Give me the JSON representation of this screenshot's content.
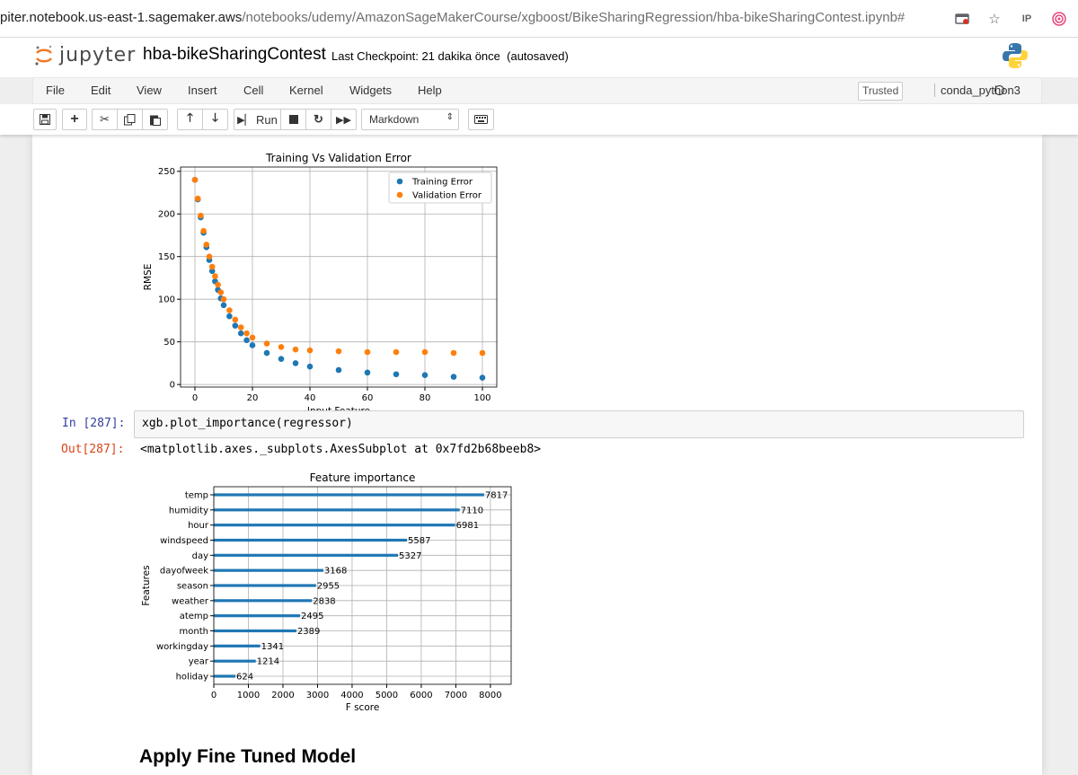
{
  "browser": {
    "url_host": "piter.notebook.us-east-1.sagemaker.aws",
    "url_path": "/notebooks/udemy/AmazonSageMakerCourse/xgboost/BikeSharingRegression/hba-bikeSharingContest.ipynb#",
    "icons": [
      "camera-blocked-icon",
      "star-icon",
      "ip-extension-icon",
      "target-extension-icon",
      "overflow-icon"
    ]
  },
  "header": {
    "logo_text": "jupyter",
    "notebook_name": "hba-bikeSharingContest",
    "checkpoint_text": "Last Checkpoint: 21 dakika önce",
    "autosave_text": "(autosaved)"
  },
  "menu": {
    "items": [
      "File",
      "Edit",
      "View",
      "Insert",
      "Cell",
      "Kernel",
      "Widgets",
      "Help"
    ],
    "trusted_label": "Trusted",
    "kernel_label": "conda_python3"
  },
  "toolbar": {
    "run_label": "Run",
    "cell_type": "Markdown"
  },
  "cells": {
    "in_prompt": "In [287]:",
    "code": "xgb.plot_importance(regressor)",
    "out_prompt": "Out[287]:",
    "output": "<matplotlib.axes._subplots.AxesSubplot at 0x7fd2b68beeb8>",
    "markdown_heading": "Apply Fine Tuned Model"
  },
  "colors": {
    "training": "#1f77b4",
    "validation": "#ff7f0e",
    "bars": "#1f77b4",
    "in_prompt": "#303f9f",
    "out_prompt": "#d84315"
  },
  "chart_data": [
    {
      "type": "scatter",
      "title": "Training Vs Validation Error",
      "xlabel": "Input Feature",
      "ylabel": "RMSE",
      "xlim": [
        -5,
        105
      ],
      "ylim": [
        -3,
        255
      ],
      "xticks": [
        0,
        20,
        40,
        60,
        80,
        100
      ],
      "yticks": [
        0,
        50,
        100,
        150,
        200,
        250
      ],
      "grid": true,
      "legend": "top-right",
      "series": [
        {
          "name": "Training Error",
          "x": [
            0,
            1,
            2,
            3,
            4,
            5,
            6,
            7,
            8,
            9,
            10,
            12,
            14,
            16,
            18,
            20,
            25,
            30,
            35,
            40,
            50,
            60,
            70,
            80,
            90,
            100
          ],
          "y": [
            240,
            217,
            196,
            178,
            161,
            146,
            133,
            121,
            111,
            101,
            93,
            80,
            69,
            60,
            52,
            46,
            37,
            30,
            25,
            21,
            17,
            14,
            12,
            11,
            9,
            8
          ]
        },
        {
          "name": "Validation Error",
          "x": [
            0,
            1,
            2,
            3,
            4,
            5,
            6,
            7,
            8,
            9,
            10,
            12,
            14,
            16,
            18,
            20,
            25,
            30,
            35,
            40,
            50,
            60,
            70,
            80,
            90,
            100
          ],
          "y": [
            240,
            218,
            198,
            180,
            164,
            150,
            138,
            127,
            117,
            108,
            100,
            87,
            76,
            67,
            60,
            55,
            48,
            44,
            41,
            40,
            39,
            38,
            38,
            38,
            37,
            37
          ]
        }
      ]
    },
    {
      "type": "bar",
      "orientation": "horizontal",
      "title": "Feature importance",
      "xlabel": "F score",
      "ylabel": "Features",
      "xlim": [
        0,
        8600
      ],
      "xticks": [
        0,
        1000,
        2000,
        3000,
        4000,
        5000,
        6000,
        7000,
        8000
      ],
      "grid": true,
      "categories": [
        "temp",
        "humidity",
        "hour",
        "windspeed",
        "day",
        "dayofweek",
        "season",
        "weather",
        "atemp",
        "month",
        "workingday",
        "year",
        "holiday"
      ],
      "values": [
        7817,
        7110,
        6981,
        5587,
        5327,
        3168,
        2955,
        2838,
        2495,
        2389,
        1341,
        1214,
        624
      ],
      "value_labels": [
        "7817",
        "7110",
        "6981",
        "5587",
        "5327",
        "3168",
        "2955",
        "2838",
        "2495",
        "2389",
        "1341",
        "1214",
        "624"
      ]
    }
  ]
}
